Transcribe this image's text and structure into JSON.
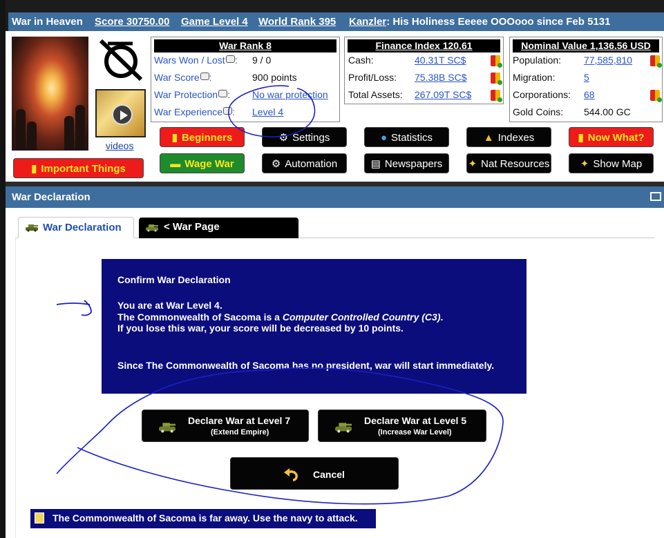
{
  "header": {
    "game_title": "War in Heaven",
    "score": "Score 30750.00",
    "game_level": "Game Level 4",
    "world_rank": "World Rank 395",
    "ruler_title": "Kanzler",
    "ruler_text": ": His Holiness Eeeee OOOooo since Feb 5131",
    "videos_label": "videos"
  },
  "war_panel": {
    "title": "War Rank 8",
    "rows": [
      {
        "label": "Wars Won / Lost",
        "value": "9 / 0"
      },
      {
        "label": "War Score",
        "value": "900 points"
      },
      {
        "label": "War Protection",
        "value": "No war protection"
      },
      {
        "label": "War Experience",
        "value": "Level 4"
      }
    ]
  },
  "finance_panel": {
    "title": "Finance Index 120.61",
    "rows": [
      {
        "label": "Cash:",
        "value": "40.31T SC$"
      },
      {
        "label": "Profit/Loss:",
        "value": "75.38B SC$"
      },
      {
        "label": "Total Assets:",
        "value": "267.09T SC$"
      }
    ]
  },
  "nominal_panel": {
    "title": "Nominal Value 1,136.56 USD",
    "rows": [
      {
        "label": "Population:",
        "value": "77,585,810"
      },
      {
        "label": "Migration:",
        "value": "5"
      },
      {
        "label": "Corporations:",
        "value": "68"
      },
      {
        "label": "Gold Coins:",
        "value": "544.00 GC"
      }
    ]
  },
  "nav": {
    "important": "Important Things",
    "beginners": "Beginners",
    "settings": "Settings",
    "statistics": "Statistics",
    "indexes": "Indexes",
    "now_what": "Now What?",
    "wage_war": "Wage War",
    "automation": "Automation",
    "newspapers": "Newspapers",
    "nat_resources": "Nat Resources",
    "show_map": "Show Map"
  },
  "section": {
    "title": "War Declaration",
    "tab_active": "War Declaration",
    "tab_war_page": "< War Page"
  },
  "confirm": {
    "heading": "Confirm War Declaration",
    "line1": "You are at War Level 4.",
    "line2_prefix": "The Commonwealth of Sacoma is a ",
    "line2_em": "Computer Controlled Country (C3)",
    "line2_suffix": ".",
    "line3": "If you lose this war, your score will be decreased by 10 points.",
    "line4": "Since The Commonwealth of Sacoma has no president, war will start immediately."
  },
  "actions": {
    "declare7_main": "Declare War at Level 7",
    "declare7_sub": "(Extend Empire)",
    "declare5_main": "Declare War at Level 5",
    "declare5_sub": "(Increase War Level)",
    "cancel": "Cancel"
  },
  "notice": "The Commonwealth of Sacoma is far away. Use the navy to attack.",
  "colors": {
    "title_bar": "#3e6e9e",
    "confirm_bg": "#0b0d7c",
    "red_button": "#ee1b1b",
    "green_button": "#1f8b2c",
    "link": "#2a55c8",
    "annotation_ink": "#1a1fc9"
  },
  "icons": {
    "clock": "clock-slash-logo-icon",
    "video": "play-icon",
    "book": "book-icon",
    "gear": "gear-icon",
    "globe": "globe-icon",
    "trophy": "trophy-icon",
    "tank": "tank-icon",
    "newspaper": "newspaper-icon",
    "resources": "resources-icon",
    "undo": "undo-arrow-icon"
  }
}
